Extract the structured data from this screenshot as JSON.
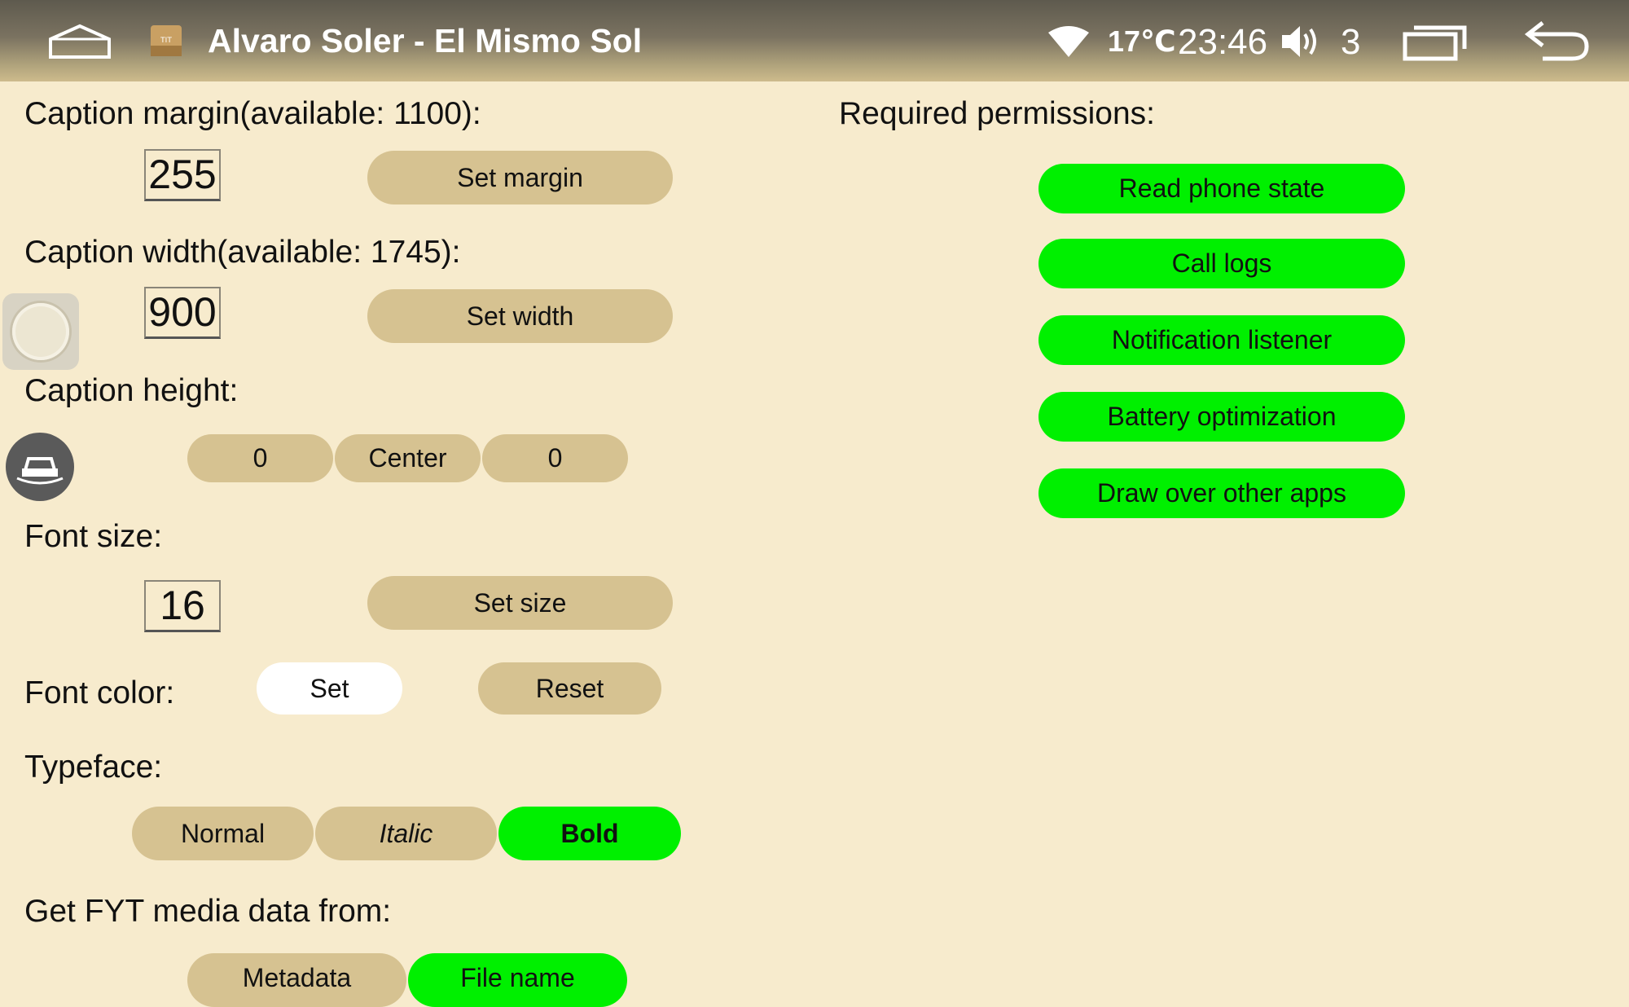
{
  "statusbar": {
    "title": "Alvaro Soler - El Mismo Sol",
    "temperature": "17℃",
    "time": "23:46",
    "volume": "3",
    "icons": [
      "home-icon",
      "app-icon",
      "wifi-icon",
      "volume-icon",
      "recent-apps-icon",
      "back-icon"
    ]
  },
  "caption_margin": {
    "label": "Caption margin(available: 1100):",
    "value": "255",
    "button": "Set margin"
  },
  "caption_width": {
    "label": "Caption width(available: 1745):",
    "value": "900",
    "button": "Set width"
  },
  "caption_height": {
    "label": "Caption height:",
    "left": "0",
    "center": "Center",
    "right": "0"
  },
  "font_size": {
    "label": "Font size:",
    "value": "16",
    "button": "Set size"
  },
  "font_color": {
    "label": "Font color:",
    "set": "Set",
    "reset": "Reset"
  },
  "typeface": {
    "label": "Typeface:",
    "options": [
      "Normal",
      "Italic",
      "Bold"
    ],
    "selected": "Bold"
  },
  "media_source": {
    "label": "Get FYT media data from:",
    "options": [
      "Metadata",
      "File name"
    ],
    "selected": "File name"
  },
  "permissions": {
    "label": "Required permissions:",
    "buttons": [
      "Read phone state",
      "Call logs",
      "Notification listener",
      "Battery optimization",
      "Draw over other apps"
    ]
  },
  "colors": {
    "background": "#f7ebcd",
    "button": "#d6c291",
    "active": "#00f000",
    "white": "#ffffff"
  }
}
